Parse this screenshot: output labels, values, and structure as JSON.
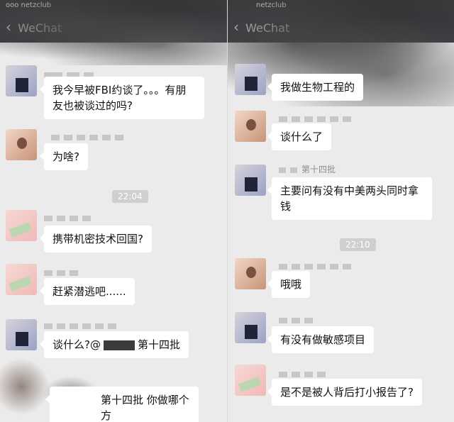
{
  "left": {
    "statusbar": {
      "carrier": "ooo netzclub"
    },
    "navbar": {
      "back_label": "WeChat"
    },
    "messages": [
      {
        "text": "我今早被FBI约谈了。。。有朋\n友也被谈过的吗?"
      },
      {
        "text": "为啥?"
      },
      {
        "text": "携带机密技术回国?"
      },
      {
        "text": "赶紧潜逃吧......"
      },
      {
        "text_prefix": "谈什么?@",
        "text_suffix": "第十四批"
      },
      {
        "name": "第十四批",
        "text": "你做哪个方"
      }
    ],
    "timestamp": "22:04"
  },
  "right": {
    "statusbar": {
      "carrier": "netzclub"
    },
    "navbar": {
      "back_label": "WeChat"
    },
    "messages": [
      {
        "text": "我做生物工程的"
      },
      {
        "text": "谈什么了"
      },
      {
        "name": "第十四批",
        "text": "主要问有没有中美两头同时拿\n钱"
      },
      {
        "text": "哦哦"
      },
      {
        "text": "有没有做敏感项目"
      },
      {
        "text": "是不是被人背后打小报告了?"
      }
    ],
    "timestamp": "22:10"
  }
}
